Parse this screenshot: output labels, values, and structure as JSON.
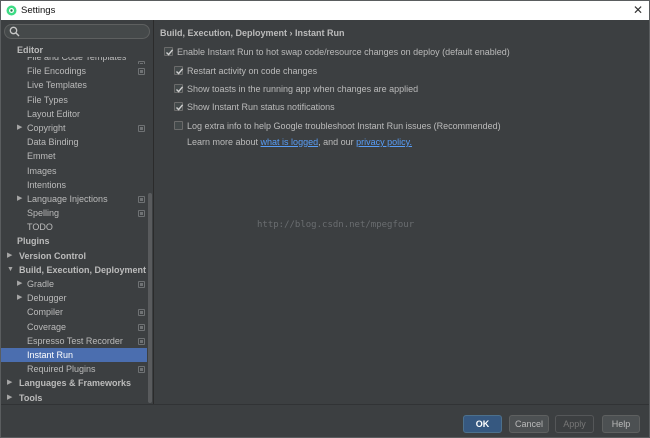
{
  "window": {
    "title": "Settings"
  },
  "sidebar": {
    "search_placeholder": "",
    "items": [
      {
        "label": "Editor",
        "level": 0,
        "kind": "section"
      },
      {
        "label": "File and Code Templates",
        "level": 1,
        "config": true,
        "clipped": true
      },
      {
        "label": "File Encodings",
        "level": 1,
        "config": true
      },
      {
        "label": "Live Templates",
        "level": 1
      },
      {
        "label": "File Types",
        "level": 1
      },
      {
        "label": "Layout Editor",
        "level": 1
      },
      {
        "label": "Copyright",
        "level": 1,
        "expandable": true,
        "config": true
      },
      {
        "label": "Data Binding",
        "level": 1
      },
      {
        "label": "Emmet",
        "level": 1
      },
      {
        "label": "Images",
        "level": 1
      },
      {
        "label": "Intentions",
        "level": 1
      },
      {
        "label": "Language Injections",
        "level": 1,
        "expandable": true,
        "config": true
      },
      {
        "label": "Spelling",
        "level": 1,
        "config": true
      },
      {
        "label": "TODO",
        "level": 1
      },
      {
        "label": "Plugins",
        "level": 0,
        "kind": "section"
      },
      {
        "label": "Version Control",
        "level": 0,
        "kind": "section",
        "expandable": true
      },
      {
        "label": "Build, Execution, Deployment",
        "level": 0,
        "kind": "section",
        "expanded": true
      },
      {
        "label": "Gradle",
        "level": 1,
        "expandable": true,
        "config": true
      },
      {
        "label": "Debugger",
        "level": 1,
        "expandable": true
      },
      {
        "label": "Compiler",
        "level": 1,
        "config": true
      },
      {
        "label": "Coverage",
        "level": 1,
        "config": true
      },
      {
        "label": "Espresso Test Recorder",
        "level": 1,
        "config": true
      },
      {
        "label": "Instant Run",
        "level": 1,
        "selected": true
      },
      {
        "label": "Required Plugins",
        "level": 1,
        "config": true
      },
      {
        "label": "Languages & Frameworks",
        "level": 0,
        "kind": "section",
        "expandable": true
      },
      {
        "label": "Tools",
        "level": 0,
        "kind": "section",
        "expandable": true
      }
    ]
  },
  "main": {
    "breadcrumb": "Build, Execution, Deployment › Instant Run",
    "options": [
      {
        "label": "Enable Instant Run to hot swap code/resource changes on deploy (default enabled)",
        "checked": true,
        "indent": 0
      },
      {
        "label": "Restart activity on code changes",
        "checked": true,
        "indent": 1
      },
      {
        "label": "Show toasts in the running app when changes are applied",
        "checked": true,
        "indent": 1
      },
      {
        "label": "Show Instant Run status notifications",
        "checked": true,
        "indent": 1
      },
      {
        "label": "Log extra info to help Google troubleshoot Instant Run issues (Recommended)",
        "checked": false,
        "indent": 1
      }
    ],
    "learn_more": {
      "prefix": "Learn more about ",
      "link1": "what is logged",
      "middle": ", and our ",
      "link2": "privacy policy."
    },
    "watermark": "http://blog.csdn.net/mpegfour"
  },
  "footer": {
    "ok_label": "OK",
    "cancel_label": "Cancel",
    "apply_label": "Apply",
    "help_label": "Help"
  },
  "colors": {
    "background": "#3c3f41",
    "selection": "#4b6eaf",
    "link": "#589df6",
    "ok_button": "#365880"
  }
}
